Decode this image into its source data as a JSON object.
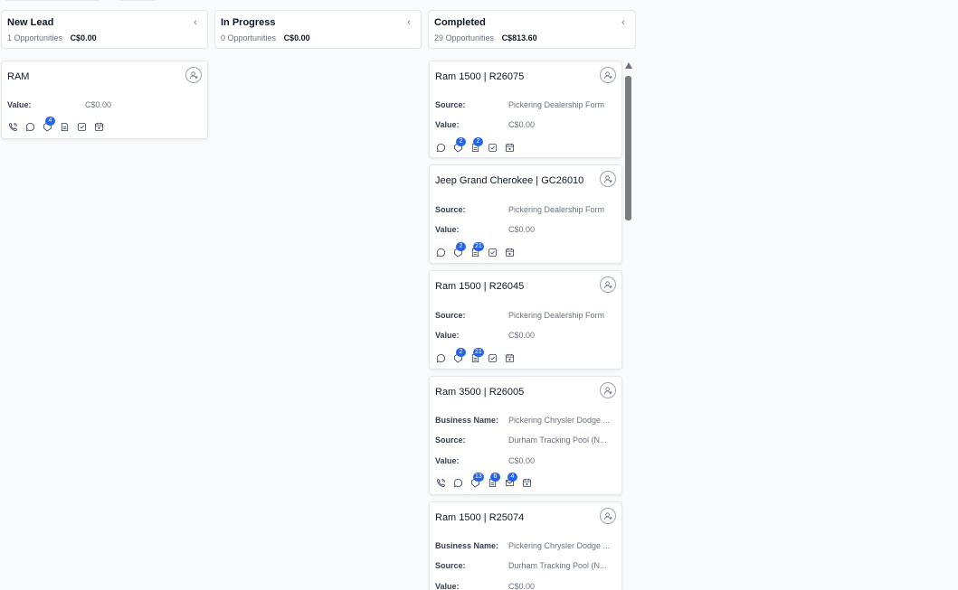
{
  "columns": [
    {
      "title": "New Lead",
      "count": "1 Opportunities",
      "amount": "C$0.00"
    },
    {
      "title": "In Progress",
      "count": "0 Opportunities",
      "amount": "C$0.00"
    },
    {
      "title": "Completed",
      "count": "29 Opportunities",
      "amount": "C$813.60"
    }
  ],
  "labels": {
    "value": "Value:",
    "source": "Source:",
    "business": "Business Name:"
  },
  "cards": [
    {
      "title": "RAM",
      "value": "C$0.00",
      "badges": {
        "tag": "4"
      }
    },
    {
      "title": "Ram 1500 | R26075",
      "source": "Pickering Dealership Form",
      "value": "C$0.00",
      "badges": {
        "tag": "2",
        "note": "2"
      }
    },
    {
      "title": "Jeep Grand Cherokee | GC26010",
      "source": "Pickering Dealership Form",
      "value": "C$0.00",
      "badges": {
        "tag": "2",
        "note": "21"
      }
    },
    {
      "title": "Ram 1500 | R26045",
      "source": "Pickering Dealership Form",
      "value": "C$0.00",
      "badges": {
        "tag": "2",
        "note": "21"
      }
    },
    {
      "title": "Ram 3500 | R26005",
      "business": "Pickering Chrysler Dodge ...",
      "source": "Durham Tracking Pool (N...",
      "value": "C$0.00",
      "badges": {
        "tag": "13",
        "note": "6",
        "mail": "4"
      }
    },
    {
      "title": "Ram 1500 | R25074",
      "business": "Pickering Chrysler Dodge ...",
      "source": "Durham Tracking Pool (N...",
      "value": "C$0.00"
    }
  ],
  "icons": {
    "call": "phone-icon",
    "chat": "chat-icon",
    "tag": "tag-icon",
    "note": "note-icon",
    "task": "task-icon",
    "calendar": "calendar-icon",
    "mail": "mail-icon",
    "assign": "user-add-icon"
  }
}
